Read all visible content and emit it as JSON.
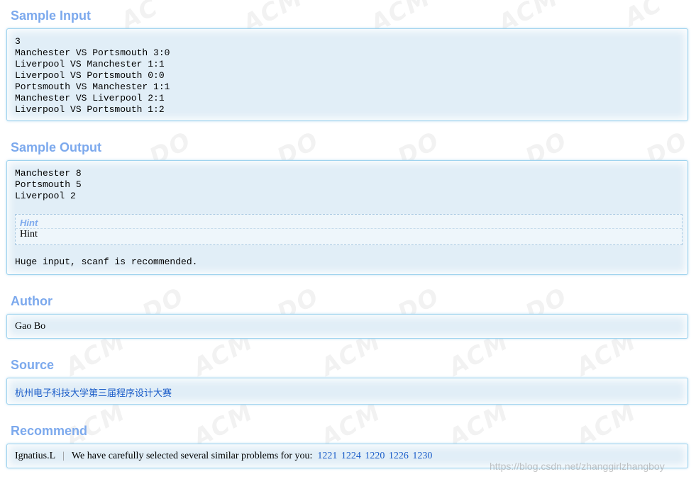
{
  "sample_input": {
    "title": "Sample Input",
    "text": "3\nManchester VS Portsmouth 3:0\nLiverpool VS Manchester 1:1\nLiverpool VS Portsmouth 0:0\nPortsmouth VS Manchester 1:1\nManchester VS Liverpool 2:1\nLiverpool VS Portsmouth 1:2"
  },
  "sample_output": {
    "title": "Sample Output",
    "text": "Manchester 8\nPortsmouth 5\nLiverpool 2",
    "hint": {
      "title": "Hint",
      "body": "Hint"
    },
    "note": "Huge input, scanf is recommended."
  },
  "author": {
    "title": "Author",
    "text": "Gao Bo"
  },
  "source": {
    "title": "Source",
    "link": "杭州电子科技大学第三届程序设计大赛"
  },
  "recommend": {
    "title": "Recommend",
    "user": "Ignatius.L",
    "separator": "|",
    "message": "We have carefully selected several similar problems for you:",
    "problems": [
      "1221",
      "1224",
      "1220",
      "1226",
      "1230"
    ]
  },
  "watermark_url": "https://blog.csdn.net/zhanggirlzhangboy",
  "colors": {
    "title": "#7ca9ed",
    "panel_bg": "#e1eef7",
    "panel_border": "#9fd3ee",
    "link": "#1a5cc8"
  }
}
